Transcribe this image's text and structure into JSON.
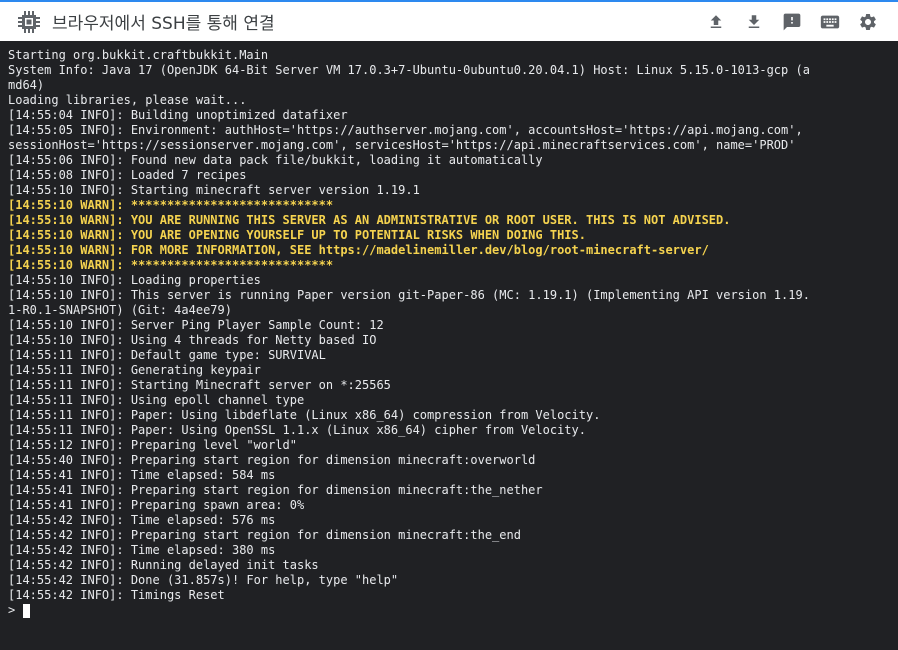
{
  "header": {
    "title": "브라우저에서 SSH를 통해 연결",
    "app_icon": "chip-icon",
    "actions": [
      {
        "name": "upload-icon"
      },
      {
        "name": "download-icon"
      },
      {
        "name": "feedback-icon"
      },
      {
        "name": "keyboard-icon"
      },
      {
        "name": "settings-icon"
      }
    ]
  },
  "terminal": {
    "lines": [
      {
        "text": "Starting org.bukkit.craftbukkit.Main",
        "level": "info"
      },
      {
        "text": "System Info: Java 17 (OpenJDK 64-Bit Server VM 17.0.3+7-Ubuntu-0ubuntu0.20.04.1) Host: Linux 5.15.0-1013-gcp (a",
        "level": "info"
      },
      {
        "text": "md64)",
        "level": "info"
      },
      {
        "text": "Loading libraries, please wait...",
        "level": "info"
      },
      {
        "text": "[14:55:04 INFO]: Building unoptimized datafixer",
        "level": "info"
      },
      {
        "text": "[14:55:05 INFO]: Environment: authHost='https://authserver.mojang.com', accountsHost='https://api.mojang.com',",
        "level": "info"
      },
      {
        "text": "sessionHost='https://sessionserver.mojang.com', servicesHost='https://api.minecraftservices.com', name='PROD'",
        "level": "info"
      },
      {
        "text": "[14:55:06 INFO]: Found new data pack file/bukkit, loading it automatically",
        "level": "info"
      },
      {
        "text": "[14:55:08 INFO]: Loaded 7 recipes",
        "level": "info"
      },
      {
        "text": "[14:55:10 INFO]: Starting minecraft server version 1.19.1",
        "level": "info"
      },
      {
        "text": "[14:55:10 WARN]: ****************************",
        "level": "warn"
      },
      {
        "text": "[14:55:10 WARN]: YOU ARE RUNNING THIS SERVER AS AN ADMINISTRATIVE OR ROOT USER. THIS IS NOT ADVISED.",
        "level": "warn"
      },
      {
        "text": "[14:55:10 WARN]: YOU ARE OPENING YOURSELF UP TO POTENTIAL RISKS WHEN DOING THIS.",
        "level": "warn"
      },
      {
        "text": "[14:55:10 WARN]: FOR MORE INFORMATION, SEE https://madelinemiller.dev/blog/root-minecraft-server/",
        "level": "warn"
      },
      {
        "text": "[14:55:10 WARN]: ****************************",
        "level": "warn"
      },
      {
        "text": "[14:55:10 INFO]: Loading properties",
        "level": "info"
      },
      {
        "text": "[14:55:10 INFO]: This server is running Paper version git-Paper-86 (MC: 1.19.1) (Implementing API version 1.19.",
        "level": "info"
      },
      {
        "text": "1-R0.1-SNAPSHOT) (Git: 4a4ee79)",
        "level": "info"
      },
      {
        "text": "[14:55:10 INFO]: Server Ping Player Sample Count: 12",
        "level": "info"
      },
      {
        "text": "[14:55:10 INFO]: Using 4 threads for Netty based IO",
        "level": "info"
      },
      {
        "text": "[14:55:11 INFO]: Default game type: SURVIVAL",
        "level": "info"
      },
      {
        "text": "[14:55:11 INFO]: Generating keypair",
        "level": "info"
      },
      {
        "text": "[14:55:11 INFO]: Starting Minecraft server on *:25565",
        "level": "info"
      },
      {
        "text": "[14:55:11 INFO]: Using epoll channel type",
        "level": "info"
      },
      {
        "text": "[14:55:11 INFO]: Paper: Using libdeflate (Linux x86_64) compression from Velocity.",
        "level": "info"
      },
      {
        "text": "[14:55:11 INFO]: Paper: Using OpenSSL 1.1.x (Linux x86_64) cipher from Velocity.",
        "level": "info"
      },
      {
        "text": "[14:55:12 INFO]: Preparing level \"world\"",
        "level": "info"
      },
      {
        "text": "[14:55:40 INFO]: Preparing start region for dimension minecraft:overworld",
        "level": "info"
      },
      {
        "text": "[14:55:41 INFO]: Time elapsed: 584 ms",
        "level": "info"
      },
      {
        "text": "[14:55:41 INFO]: Preparing start region for dimension minecraft:the_nether",
        "level": "info"
      },
      {
        "text": "[14:55:41 INFO]: Preparing spawn area: 0%",
        "level": "info"
      },
      {
        "text": "[14:55:42 INFO]: Time elapsed: 576 ms",
        "level": "info"
      },
      {
        "text": "[14:55:42 INFO]: Preparing start region for dimension minecraft:the_end",
        "level": "info"
      },
      {
        "text": "[14:55:42 INFO]: Time elapsed: 380 ms",
        "level": "info"
      },
      {
        "text": "[14:55:42 INFO]: Running delayed init tasks",
        "level": "info"
      },
      {
        "text": "[14:55:42 INFO]: Done (31.857s)! For help, type \"help\"",
        "level": "info"
      },
      {
        "text": "[14:55:42 INFO]: Timings Reset",
        "level": "info"
      }
    ],
    "prompt": ">"
  },
  "colors": {
    "terminal_bg": "#202124",
    "terminal_text": "#e8eaed",
    "warn_text": "#f5d34f",
    "header_accent": "#2d89ef"
  }
}
